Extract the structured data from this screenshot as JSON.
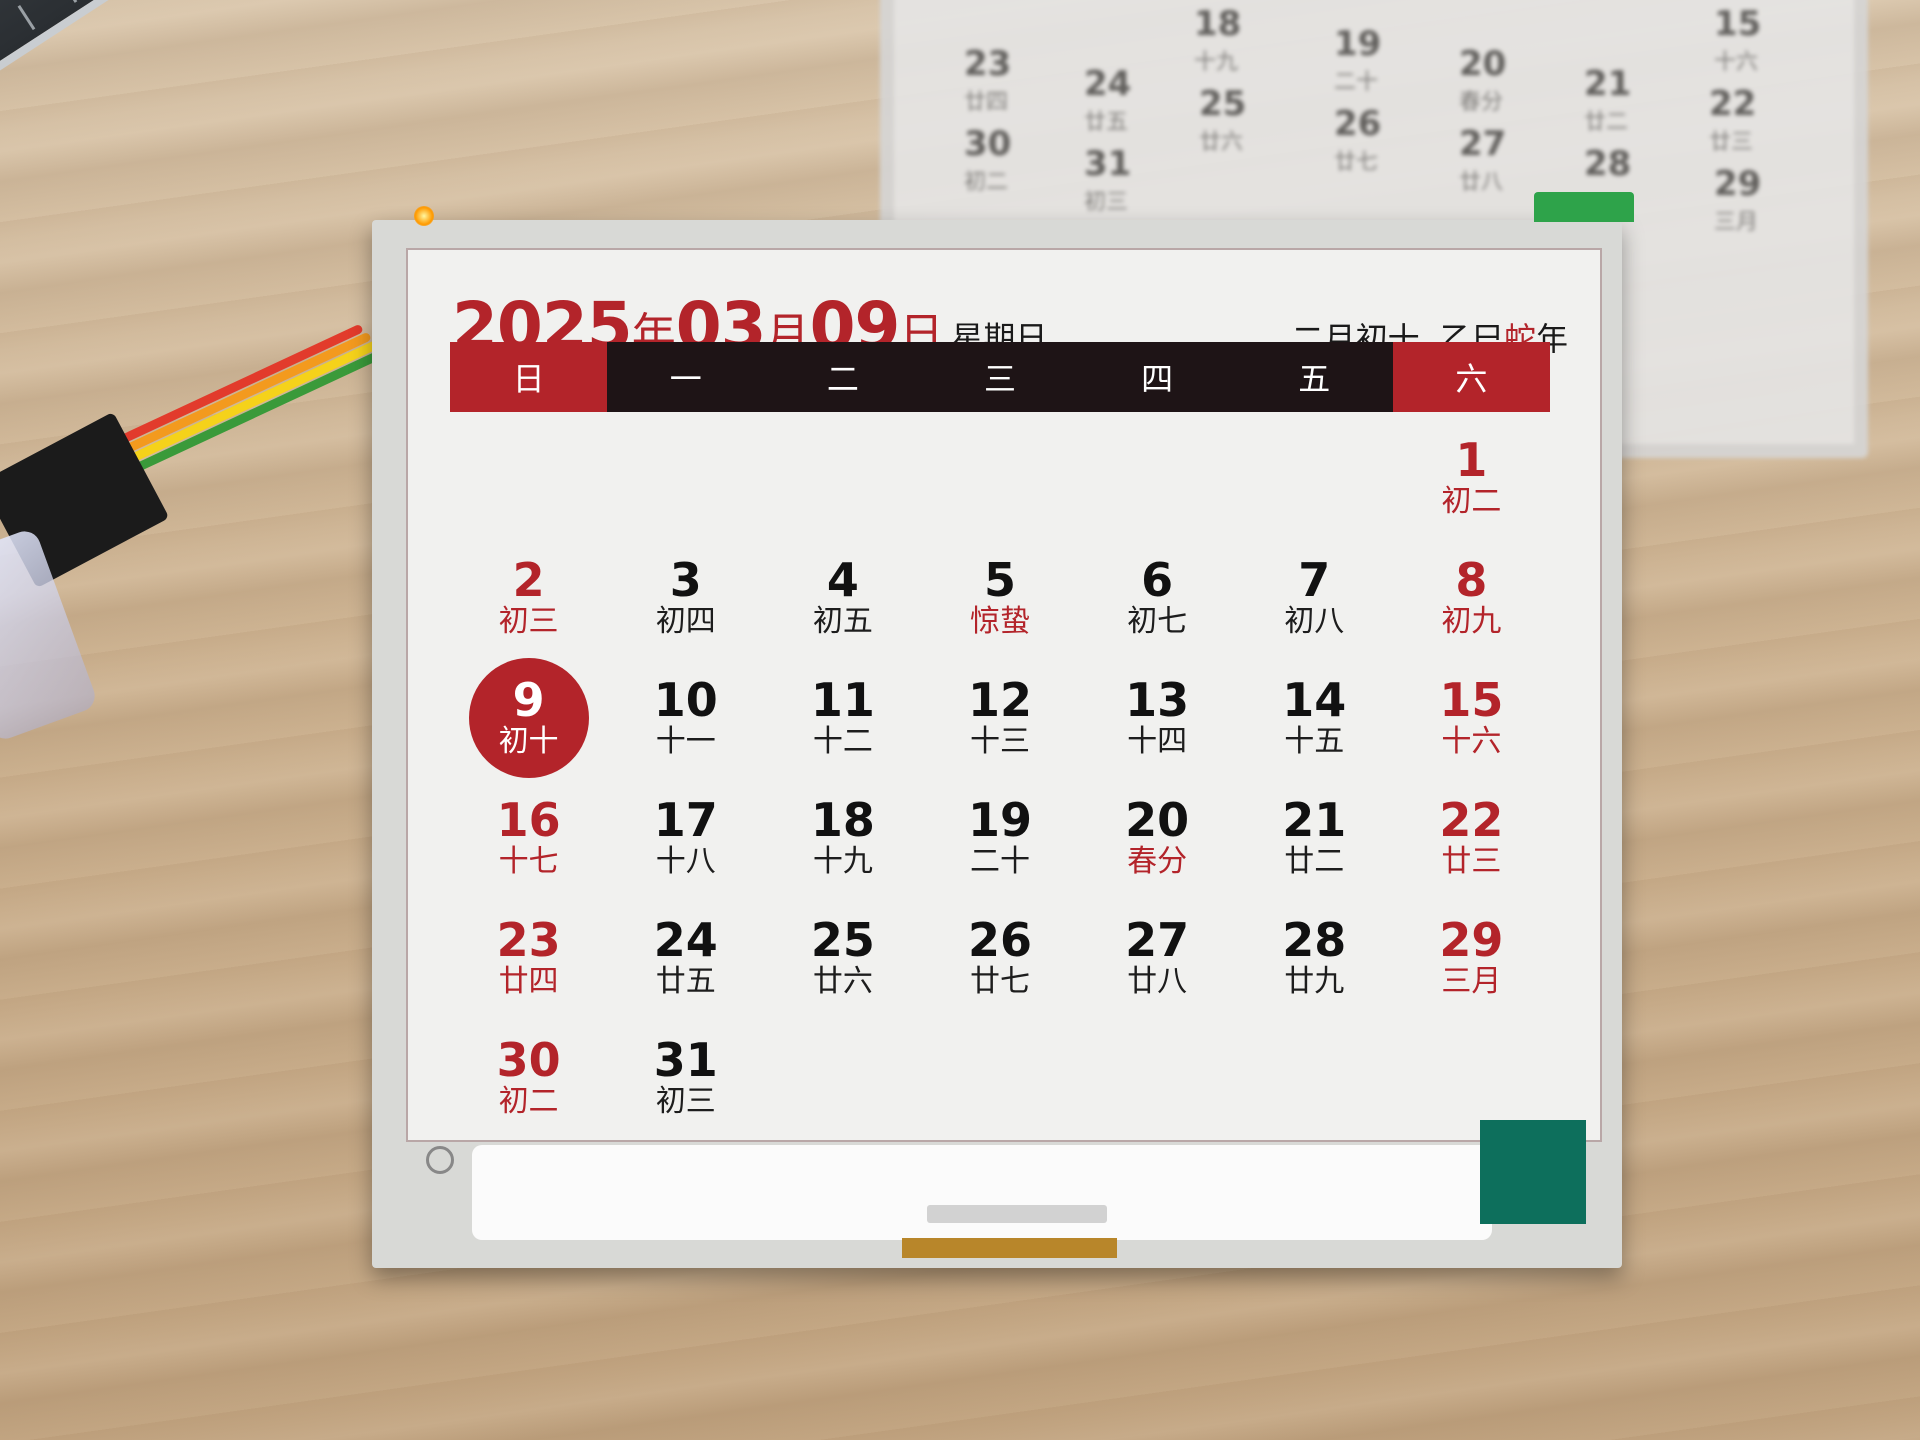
{
  "display": {
    "year": "2025",
    "year_unit": "年",
    "month": "03",
    "month_unit": "月",
    "day": "09",
    "day_unit": "日",
    "weekday": "星期日",
    "lunar_date": "二月初十",
    "ganzhi_prefix": "乙巳",
    "zodiac": "蛇",
    "year_suffix": "年",
    "weekdays": [
      "日",
      "一",
      "二",
      "三",
      "四",
      "五",
      "六"
    ],
    "days": [
      {
        "day": "",
        "lunar": ""
      },
      {
        "day": "",
        "lunar": ""
      },
      {
        "day": "",
        "lunar": ""
      },
      {
        "day": "",
        "lunar": ""
      },
      {
        "day": "",
        "lunar": ""
      },
      {
        "day": "",
        "lunar": ""
      },
      {
        "day": "1",
        "lunar": "初二"
      },
      {
        "day": "2",
        "lunar": "初三"
      },
      {
        "day": "3",
        "lunar": "初四"
      },
      {
        "day": "4",
        "lunar": "初五"
      },
      {
        "day": "5",
        "lunar": "惊蛰"
      },
      {
        "day": "6",
        "lunar": "初七"
      },
      {
        "day": "7",
        "lunar": "初八"
      },
      {
        "day": "8",
        "lunar": "初九"
      },
      {
        "day": "9",
        "lunar": "初十"
      },
      {
        "day": "10",
        "lunar": "十一"
      },
      {
        "day": "11",
        "lunar": "十二"
      },
      {
        "day": "12",
        "lunar": "十三"
      },
      {
        "day": "13",
        "lunar": "十四"
      },
      {
        "day": "14",
        "lunar": "十五"
      },
      {
        "day": "15",
        "lunar": "十六"
      },
      {
        "day": "16",
        "lunar": "十七"
      },
      {
        "day": "17",
        "lunar": "十八"
      },
      {
        "day": "18",
        "lunar": "十九"
      },
      {
        "day": "19",
        "lunar": "二十"
      },
      {
        "day": "20",
        "lunar": "春分"
      },
      {
        "day": "21",
        "lunar": "廿二"
      },
      {
        "day": "22",
        "lunar": "廿三"
      },
      {
        "day": "23",
        "lunar": "廿四"
      },
      {
        "day": "24",
        "lunar": "廿五"
      },
      {
        "day": "25",
        "lunar": "廿六"
      },
      {
        "day": "26",
        "lunar": "廿七"
      },
      {
        "day": "27",
        "lunar": "廿八"
      },
      {
        "day": "28",
        "lunar": "廿九"
      },
      {
        "day": "29",
        "lunar": "三月"
      },
      {
        "day": "30",
        "lunar": "初二"
      },
      {
        "day": "31",
        "lunar": "初三"
      }
    ],
    "today": "9",
    "solar_terms": [
      "5",
      "20"
    ]
  },
  "background_calendar": {
    "items": [
      {
        "day": "23",
        "lunar": "廿四"
      },
      {
        "day": "24",
        "lunar": "廿五"
      },
      {
        "day": "25",
        "lunar": "廿六"
      },
      {
        "day": "18",
        "lunar": "十九"
      },
      {
        "day": "19",
        "lunar": "二十"
      },
      {
        "day": "20",
        "lunar": "春分"
      },
      {
        "day": "21",
        "lunar": "廿二"
      },
      {
        "day": "22",
        "lunar": "廿三"
      },
      {
        "day": "15",
        "lunar": "十六"
      },
      {
        "day": "26",
        "lunar": "廿七"
      },
      {
        "day": "27",
        "lunar": "廿八"
      },
      {
        "day": "28",
        "lunar": ""
      },
      {
        "day": "29",
        "lunar": "三月"
      },
      {
        "day": "30",
        "lunar": "初二"
      },
      {
        "day": "31",
        "lunar": "初三"
      }
    ]
  },
  "colors": {
    "red": "#b3242a",
    "black_bar": "#1e1416",
    "paper": "#f1f1ef"
  }
}
